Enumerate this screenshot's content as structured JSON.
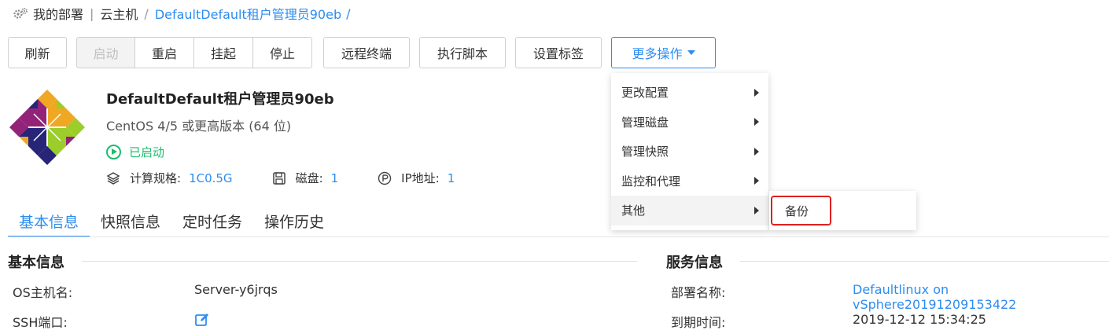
{
  "breadcrumb": {
    "items": [
      "我的部署",
      "云主机"
    ],
    "current": "DefaultDefault租户管理员90eb",
    "trailing_sep": "/"
  },
  "toolbar": {
    "refresh": "刷新",
    "start": "启动",
    "restart": "重启",
    "suspend": "挂起",
    "stop": "停止",
    "remote_terminal": "远程终端",
    "run_script": "执行脚本",
    "set_tags": "设置标签",
    "more_actions": "更多操作"
  },
  "vm": {
    "name": "DefaultDefault租户管理员90eb",
    "os": "CentOS 4/5 或更高版本 (64 位)",
    "status": "已启动",
    "specs": {
      "flavor_label": "计算规格:",
      "flavor_value": "1C0.5G",
      "disk_label": "磁盘:",
      "disk_value": "1",
      "ip_label": "IP地址:",
      "ip_value": "1"
    }
  },
  "tabs": [
    "基本信息",
    "快照信息",
    "定时任务",
    "操作历史"
  ],
  "basic_info": {
    "title": "基本信息",
    "rows": [
      {
        "label": "OS主机名:",
        "value": "Server-y6jrqs"
      },
      {
        "label": "SSH端口:",
        "value": ""
      }
    ]
  },
  "service_info": {
    "title": "服务信息",
    "rows": [
      {
        "label": "部署名称:",
        "value": "Defaultlinux on vSphere20191209153422"
      },
      {
        "label": "到期时间:",
        "value": "2019-12-12 15:34:25"
      }
    ]
  },
  "dropdown_menu": {
    "items": [
      "更改配置",
      "管理磁盘",
      "管理快照",
      "监控和代理",
      "其他"
    ],
    "submenu_items": [
      "备份"
    ]
  },
  "colors": {
    "accent": "#2d8cf0",
    "status_green": "#19be6b",
    "highlight_red": "#e02020"
  }
}
